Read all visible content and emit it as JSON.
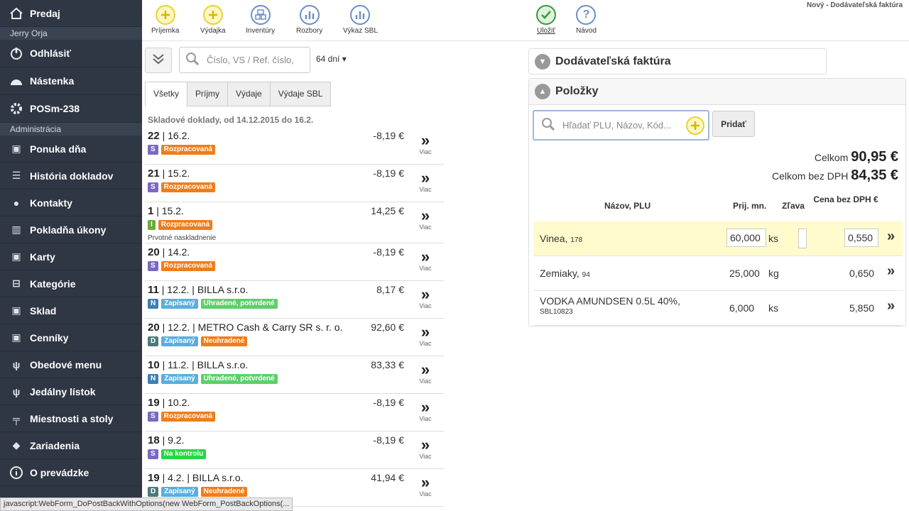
{
  "sidebar": {
    "predaj": "Predaj",
    "user": "Jerry Orja",
    "logout": "Odhlásiť",
    "dashboard": "Nástenka",
    "pos": "POSm-238",
    "section_admin": "Administrácia",
    "items": [
      "Ponuka dňa",
      "História dokladov",
      "Kontakty",
      "Pokladňa úkony",
      "Karty",
      "Kategórie",
      "Sklad",
      "Cenníky",
      "Obedové menu",
      "Jedálny lístok",
      "Miestnosti a stoly",
      "Zariadenia",
      "O prevádzke"
    ]
  },
  "toolbar": {
    "buttons": [
      "Príjemka",
      "Výdajka",
      "Inventúry",
      "Rozbory",
      "Výkaz SBL",
      "Uložiť",
      "Návod"
    ],
    "doc_title": "Nový - Dodávateľská faktúra"
  },
  "list": {
    "search_placeholder": "Číslo, VS / Ref. číslo,",
    "days": "64 dní",
    "tabs": [
      "Všetky",
      "Príjmy",
      "Výdaje",
      "Výdaje SBL"
    ],
    "heading": "Skladové doklady, od 14.12.2015 do 16.2.",
    "more_label": "Viac",
    "rows": [
      {
        "num": "22",
        "date": "16.2.",
        "partner": "",
        "amount": "-8,19 €",
        "type": "S",
        "status": "Rozpracovaná",
        "status2": "",
        "note": ""
      },
      {
        "num": "21",
        "date": "15.2.",
        "partner": "",
        "amount": "-8,19 €",
        "type": "S",
        "status": "Rozpracovaná",
        "status2": "",
        "note": ""
      },
      {
        "num": "1",
        "date": "15.2.",
        "partner": "",
        "amount": "14,25 €",
        "type": "I",
        "status": "Rozpracovaná",
        "status2": "",
        "note": "Prvotné naskladnenie"
      },
      {
        "num": "20",
        "date": "14.2.",
        "partner": "",
        "amount": "-8,19 €",
        "type": "S",
        "status": "Rozpracovaná",
        "status2": "",
        "note": ""
      },
      {
        "num": "11",
        "date": "12.2.",
        "partner": "BILLA s.r.o.",
        "amount": "8,17 €",
        "type": "N",
        "status": "Zapísaný",
        "status2": "Uhradené, potvrdené",
        "note": ""
      },
      {
        "num": "20",
        "date": "12.2.",
        "partner": "METRO Cash & Carry SR s. r. o.",
        "amount": "92,60 €",
        "type": "D",
        "status": "Zapísaný",
        "status2": "Neuhradené",
        "note": ""
      },
      {
        "num": "10",
        "date": "11.2.",
        "partner": "BILLA s.r.o.",
        "amount": "83,33 €",
        "type": "N",
        "status": "Zapísaný",
        "status2": "Uhradené, potvrdené",
        "note": ""
      },
      {
        "num": "19",
        "date": "10.2.",
        "partner": "",
        "amount": "-8,19 €",
        "type": "S",
        "status": "Rozpracovaná",
        "status2": "",
        "note": ""
      },
      {
        "num": "18",
        "date": "9.2.",
        "partner": "",
        "amount": "-8,19 €",
        "type": "S",
        "status": "Na kontrolu",
        "status2": "",
        "note": ""
      },
      {
        "num": "19",
        "date": "4.2.",
        "partner": "BILLA s.r.o.",
        "amount": "41,94 €",
        "type": "D",
        "status": "Zapísaný",
        "status2": "Neuhradené",
        "note": ""
      }
    ]
  },
  "invoice": {
    "panel_title": "Dodávateľská faktúra",
    "items_title": "Položky",
    "search_placeholder": "Hľadať PLU, Názov, Kód...",
    "add_label": "Pridať",
    "total_label": "Celkom",
    "total_value": "90,95 €",
    "total_net_label": "Celkom bez DPH",
    "total_net_value": "84,35 €",
    "columns": {
      "name": "Názov, PLU",
      "qty": "Prij. mn.",
      "discount": "Zľava",
      "price": "Cena bez DPH €"
    },
    "items": [
      {
        "name": "Vinea,",
        "plu": "178",
        "qty": "60,000",
        "unit": "ks",
        "discount": "",
        "price": "0,550"
      },
      {
        "name": "Zemiaky,",
        "plu": "94",
        "qty": "25,000",
        "unit": "kg",
        "discount": "",
        "price": "0,650"
      },
      {
        "name": "VODKA AMUNDSEN 0.5L 40%,",
        "plu": "SBL10823",
        "qty": "6,000",
        "unit": "ks",
        "discount": "",
        "price": "5,850"
      }
    ]
  },
  "statusbar": "javascript:WebForm_DoPostBackWithOptions(new WebForm_PostBackOptions(..."
}
